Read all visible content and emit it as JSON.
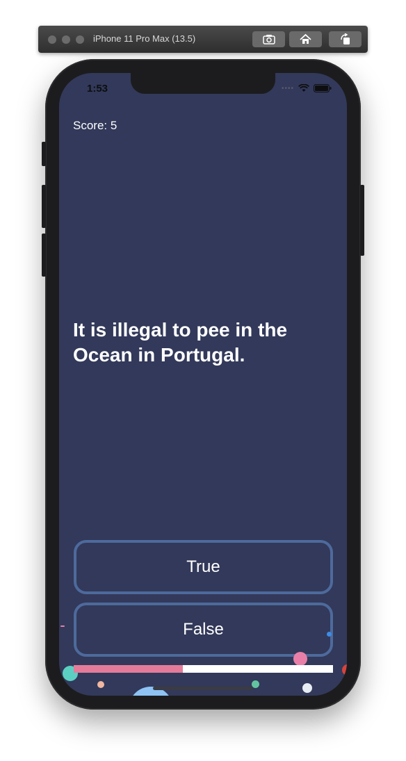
{
  "simulator": {
    "title": "iPhone 11 Pro Max (13.5)",
    "buttons": [
      "screenshot-icon",
      "home-icon",
      "rotate-icon"
    ]
  },
  "status_bar": {
    "time": "1:53",
    "icons": [
      "cellular-dots-icon",
      "wifi-icon",
      "battery-icon"
    ]
  },
  "quiz": {
    "score_text": "Score: 5",
    "question": "It is illegal to pee in the Ocean in Portugal.",
    "answers": {
      "true_label": "True",
      "false_label": "False"
    },
    "progress": 0.42
  },
  "colors": {
    "background": "#32395a",
    "button_border": "#4e6a9c",
    "progress_fill": "#e57b9a",
    "progress_track": "#ffffff"
  }
}
